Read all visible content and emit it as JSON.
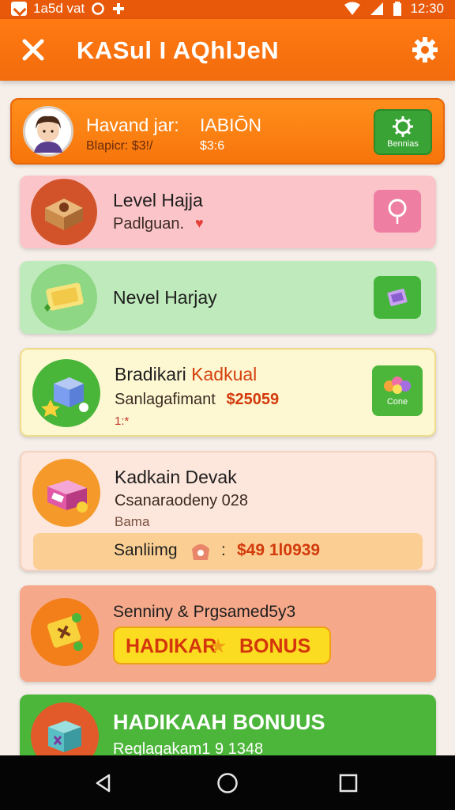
{
  "status_bar": {
    "left_text": "1a5d vat",
    "time": "12:30"
  },
  "app_bar": {
    "title": "KASul I AQhlJeN"
  },
  "profile": {
    "name": "Havand jar:",
    "tag": "IABIŌN",
    "stat_left": "Blapicr: $3!/",
    "stat_right": "$3:6",
    "button_label": "Bennias"
  },
  "items": [
    {
      "title": "Level Hajja",
      "subtitle": "Padlguan."
    },
    {
      "title": "Nevel Harjay"
    },
    {
      "title": "Bradikari",
      "title_accent": "Kadkual",
      "subtitle": "Sanlagafimant",
      "amount": "$25059",
      "note": "1:*",
      "button_label": "Cone"
    },
    {
      "title": "Kadkain Devak",
      "subtitle": "Csanaraodeny 028",
      "note": "Bama",
      "bar_label": "Sanliimg",
      "bar_sep": ":",
      "bar_amount": "$49 1l0939"
    },
    {
      "title": "Senniny & Prgsamed5y3",
      "bonus_label": "HADIKAR",
      "bonus_label2": "BONUS"
    },
    {
      "title": "HADIKAAH BONUUS",
      "subtitle": "Reqlagakam1 9 1348"
    }
  ],
  "colors": {
    "orange": "#f36b0d",
    "pink": "#fbc4c8",
    "green": "#bfeabb",
    "yellow": "#fdf7d2",
    "peach": "#fde6db",
    "salmon": "#f6a98a",
    "bright_green": "#4cb63a"
  }
}
